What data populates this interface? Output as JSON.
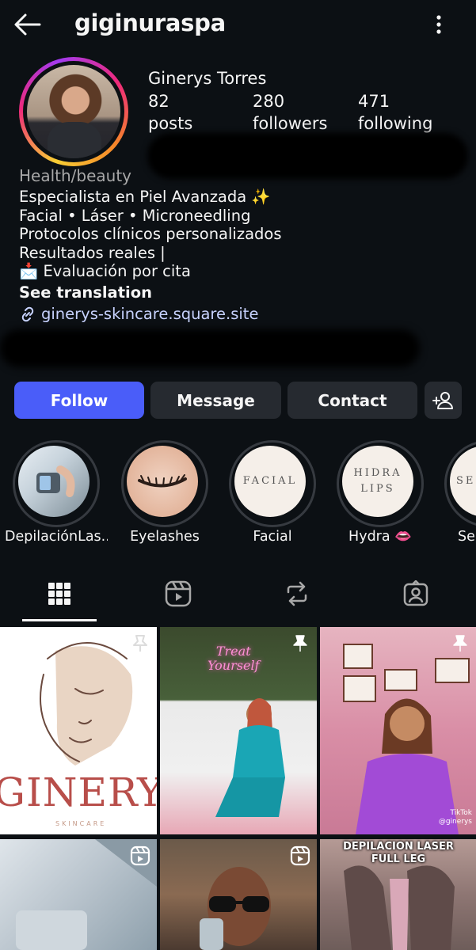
{
  "header": {
    "username": "giginuraspa"
  },
  "profile": {
    "full_name": "Ginerys Torres",
    "stats": [
      {
        "value": "82",
        "label": "posts"
      },
      {
        "value": "280",
        "label": "followers"
      },
      {
        "value": "471",
        "label": "following"
      }
    ],
    "category": "Health/beauty",
    "bio_lines": [
      "Especialista en Piel Avanzada ✨",
      "Facial • Láser • Microneedling",
      "Protocolos clínicos personalizados",
      "Resultados reales |",
      "📩 Evaluación por cita"
    ],
    "see_translation": "See translation",
    "link": "ginerys-skincare.square.site"
  },
  "actions": {
    "follow": "Follow",
    "message": "Message",
    "contact": "Contact"
  },
  "highlights": [
    {
      "label": "DepilaciónLas...",
      "cover_text": ""
    },
    {
      "label": "Eyelashes",
      "cover_text": ""
    },
    {
      "label": "Facial",
      "cover_text": "FACIAL"
    },
    {
      "label": "Hydra 👄",
      "cover_text": "HIDRA LIPS"
    },
    {
      "label": "Se",
      "cover_text": "SE"
    }
  ],
  "tabs": [
    "grid-icon",
    "reels-icon",
    "reposts-icon",
    "tagged-icon"
  ],
  "posts": [
    {
      "text_main": "GINERYS",
      "text_sub": "SKINCARE"
    },
    {
      "neon_line1": "Treat",
      "neon_line2": "Yourself"
    },
    {
      "tiktok_label": "TikTok",
      "tiktok_handle": "@ginerys"
    },
    {
      "kind": "reel"
    },
    {
      "kind": "reel"
    },
    {
      "overlay_line1": "DEPILACION LASER",
      "overlay_line2": "FULL LEG"
    }
  ],
  "colors": {
    "background": "#0c1014",
    "follow_button": "#4a5df9",
    "secondary_button": "#262a30",
    "link": "#c7d2fe",
    "muted": "#a8a8a8"
  }
}
